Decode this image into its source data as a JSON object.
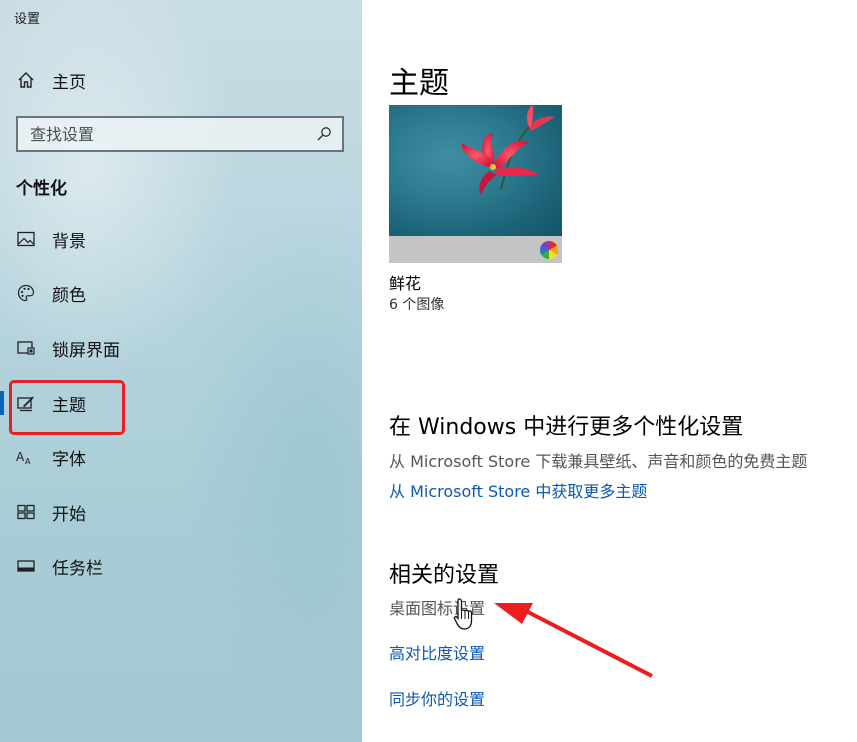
{
  "window": {
    "title": "设置"
  },
  "sidebar": {
    "home_label": "主页",
    "search_placeholder": "查找设置",
    "section_title": "个性化",
    "items": [
      {
        "label": "背景",
        "icon": "picture-icon"
      },
      {
        "label": "颜色",
        "icon": "palette-icon"
      },
      {
        "label": "锁屏界面",
        "icon": "lock-screen-icon"
      },
      {
        "label": "主题",
        "icon": "theme-brush-icon",
        "active": true
      },
      {
        "label": "字体",
        "icon": "font-icon"
      },
      {
        "label": "开始",
        "icon": "start-icon"
      },
      {
        "label": "任务栏",
        "icon": "taskbar-icon"
      }
    ]
  },
  "main": {
    "title": "主题",
    "theme": {
      "name": "鲜花",
      "count": "6 个图像"
    },
    "more": {
      "heading": "在 Windows 中进行更多个性化设置",
      "description": "从 Microsoft Store 下载兼具壁纸、声音和颜色的免费主题",
      "link": "从 Microsoft Store 中获取更多主题"
    },
    "related": {
      "heading": "相关的设置",
      "links": [
        "桌面图标设置",
        "高对比度设置",
        "同步你的设置"
      ]
    }
  },
  "colors": {
    "accent": "#0a62b7",
    "link": "#0a5ab0",
    "annotation": "#e32222"
  }
}
